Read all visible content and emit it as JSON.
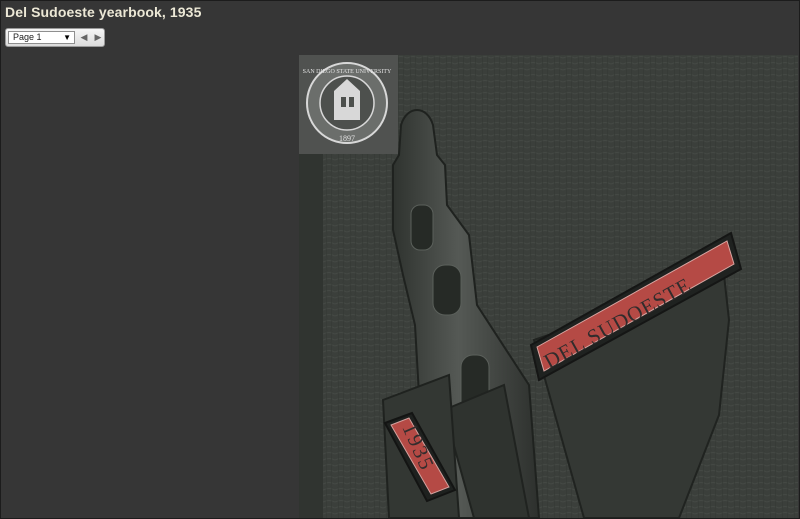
{
  "header": {
    "title": "Del Sudoeste yearbook, 1935"
  },
  "pager": {
    "selected_page": "Page 1",
    "prev_icon": "chevron-left-icon",
    "next_icon": "chevron-right-icon"
  },
  "cover": {
    "seal_text": "SAN DIEGO STATE UNIVERSITY",
    "seal_year": "1897",
    "banner_text": "DEL SUDOESTE",
    "year_text": "1935"
  },
  "colors": {
    "background": "#363636",
    "title": "#ece8d6",
    "cover": "#3b3f3b",
    "banner_red": "#b54a45"
  }
}
